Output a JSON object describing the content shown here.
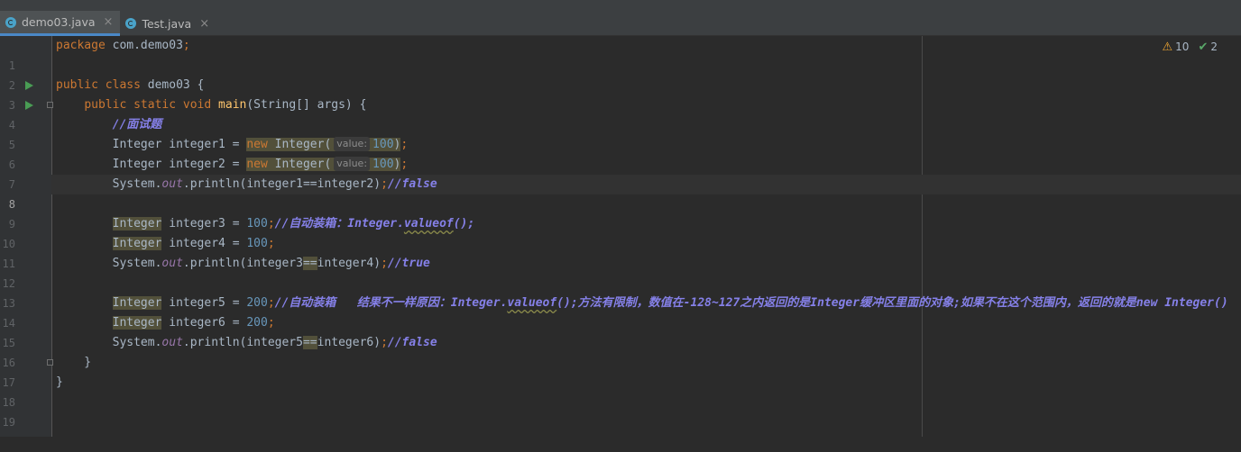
{
  "tabs": [
    {
      "label": "demo03.java",
      "close_glyph": "×",
      "active": true
    },
    {
      "label": "Test.java",
      "close_glyph": "×",
      "active": false
    }
  ],
  "inspection": {
    "warnings": "10",
    "typos": "2",
    "warning_icon": "warning-icon",
    "typo_icon": "typo-check-icon"
  },
  "code": {
    "l1_kw": "package",
    "l1_rest": " com.demo03",
    "semi": ";",
    "l3_kw1": "public",
    "l3_kw2": "class",
    "l3_name": " demo03 {",
    "l4_kw1": "public",
    "l4_kw2": "static",
    "l4_kw3": "void",
    "l4_fn": "main",
    "l4_rest": "(String[] args) {",
    "l5_cmt": "//面试题",
    "l6_a": "Integer integer1 = ",
    "l7_a": "Integer integer2 = ",
    "new_kw": "new",
    "integer_ctor": " Integer(",
    "hint_label": "value:",
    "num100": "100",
    "close_paren": ")",
    "l8_a": "System.",
    "out": "out",
    "println_i1": ".println(integer1",
    "eqeq": "==",
    "l8_b": "integer2)",
    "cmt_false": "//false",
    "cmt_true": "//true",
    "integer_type": "Integer",
    "l10_a": " integer3 = ",
    "l10_cmt_a": "//自动装箱：Integer.",
    "valueof": "valueof",
    "l10_cmt_b": "();",
    "l11_a": " integer4 = ",
    "l12_a": ".println(integer3",
    "l12_b": "integer4)",
    "l14_a": " integer5 = ",
    "num200": "200",
    "l14_cmt_a": "//自动装箱   结果不一样原因：Integer.",
    "l14_cmt_b": "();方法有限制，数值在-128~127之内返回的是Integer缓冲区里面的对象;如果不在这个范围内，返回的就是new Integer()",
    "l15_a": " integer6 = ",
    "l16_a": ".println(integer5",
    "l16_b": "integer6)",
    "l17": "    }",
    "l18": "}"
  },
  "line_numbers": [
    "1",
    "2",
    "3",
    "4",
    "5",
    "6",
    "7",
    "8",
    "9",
    "10",
    "11",
    "12",
    "13",
    "14",
    "15",
    "16",
    "17",
    "18",
    "19"
  ]
}
